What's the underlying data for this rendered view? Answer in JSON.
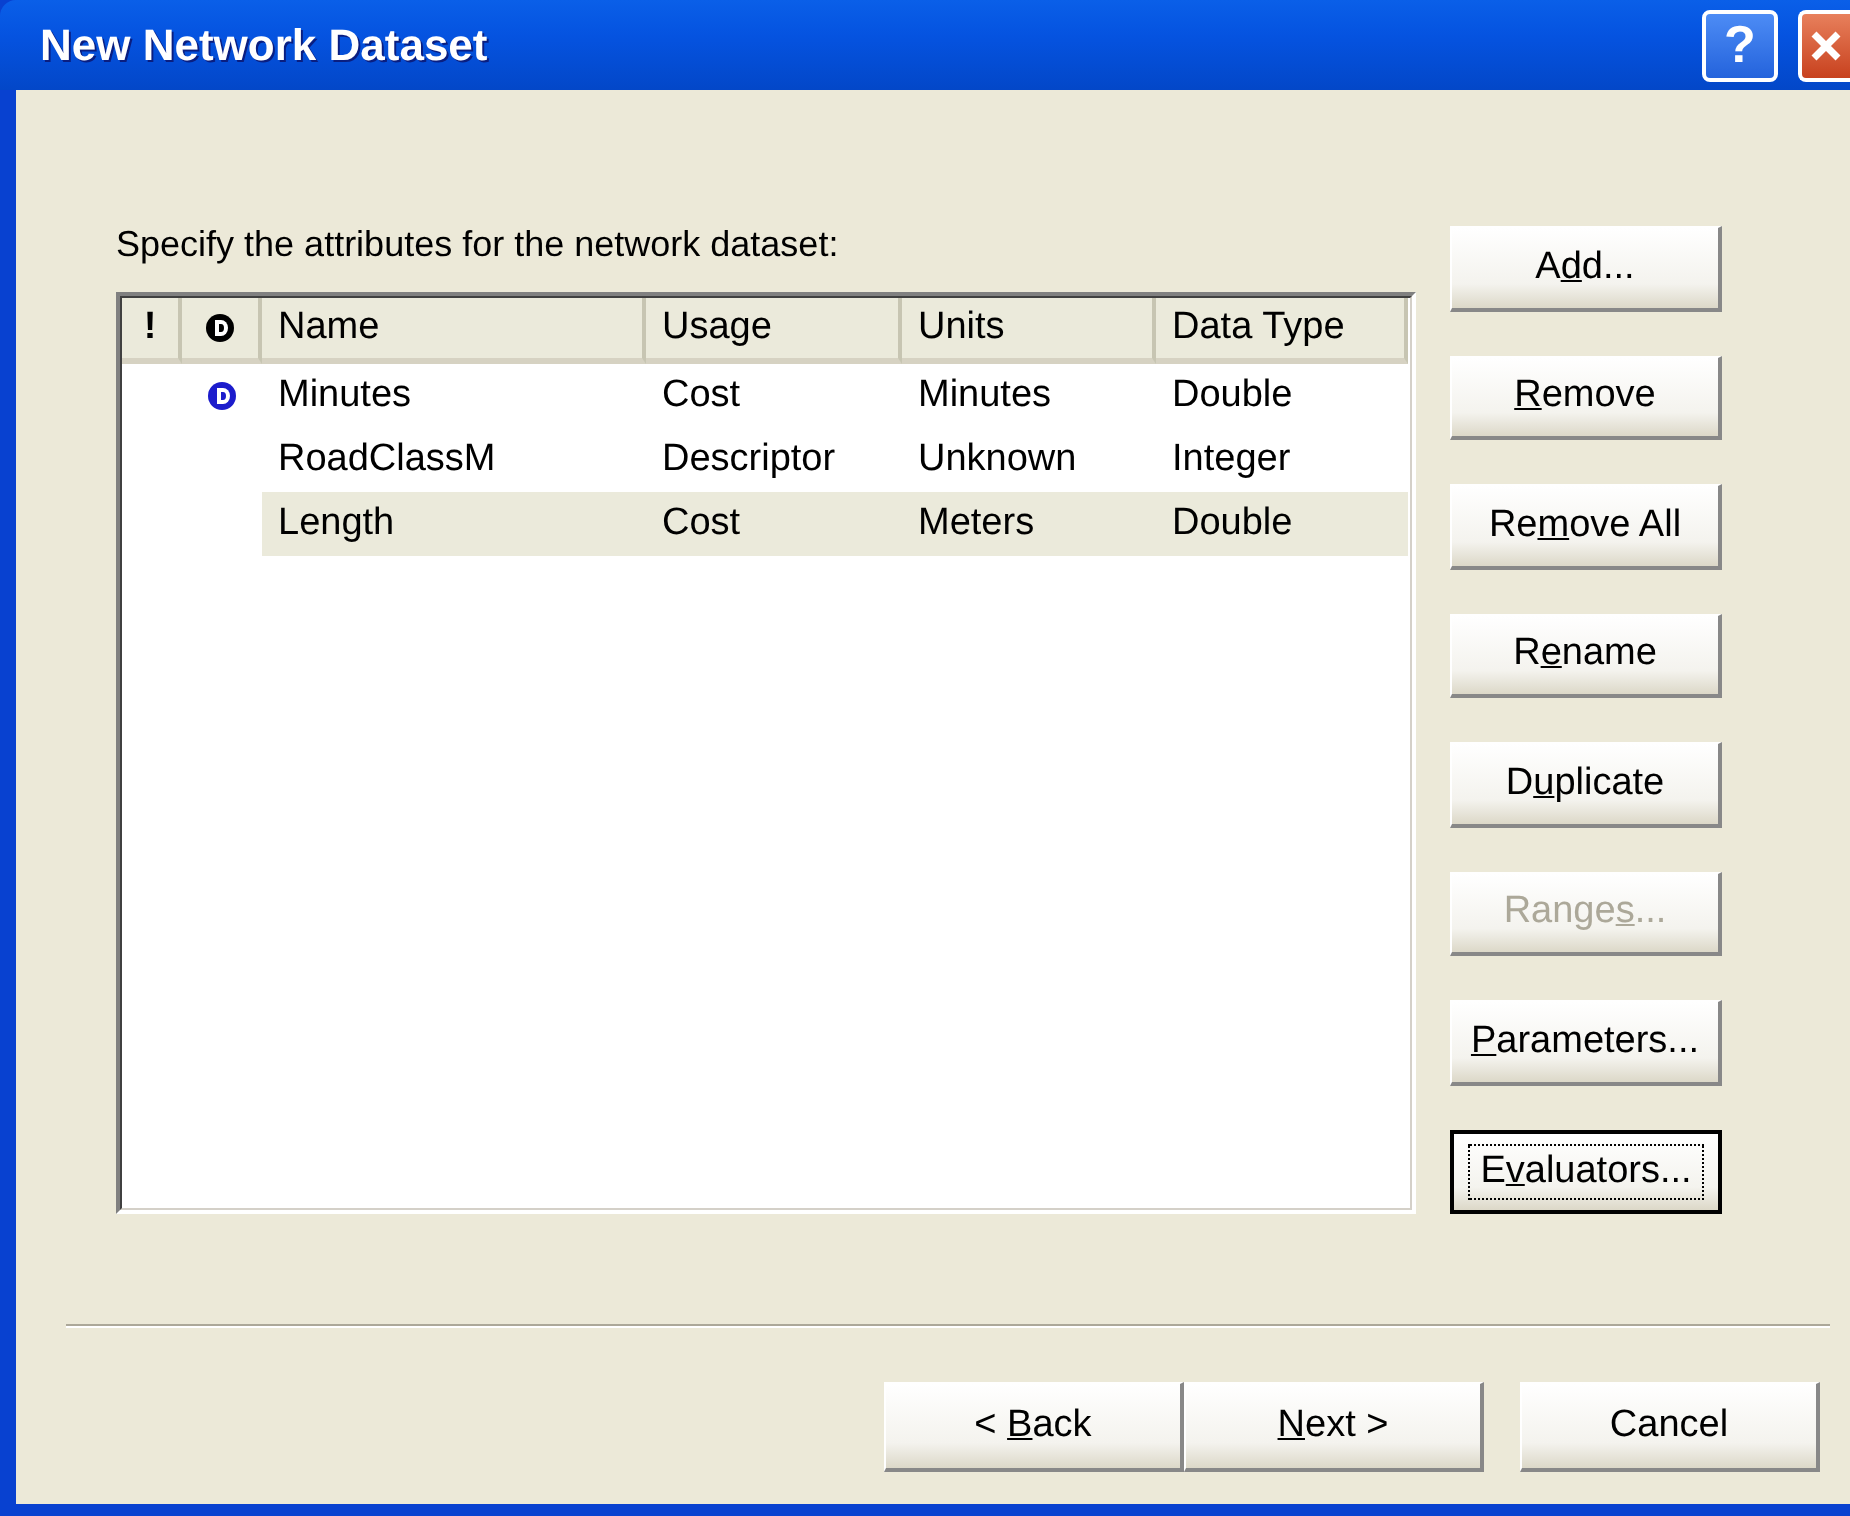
{
  "window": {
    "title": "New Network Dataset",
    "help_button": "?"
  },
  "prompt": "Specify the attributes for the network dataset:",
  "table": {
    "columns": [
      {
        "kind": "text",
        "label": "!"
      },
      {
        "kind": "icon"
      },
      {
        "kind": "text",
        "label": "Name"
      },
      {
        "kind": "text",
        "label": "Usage"
      },
      {
        "kind": "text",
        "label": "Units"
      },
      {
        "kind": "text",
        "label": "Data Type"
      }
    ],
    "rows": [
      {
        "default": true,
        "selected": false,
        "cells": [
          "",
          "",
          "Minutes",
          "Cost",
          "Minutes",
          "Double"
        ]
      },
      {
        "default": false,
        "selected": false,
        "cells": [
          "",
          "",
          "RoadClassM",
          "Descriptor",
          "Unknown",
          "Integer"
        ]
      },
      {
        "default": false,
        "selected": true,
        "cells": [
          "",
          "",
          "Length",
          "Cost",
          "Meters",
          "Double"
        ]
      }
    ]
  },
  "side_buttons": [
    {
      "pre": "A",
      "key": "d",
      "post": "d...",
      "disabled": false,
      "focused": false
    },
    {
      "key": "R",
      "post": "emove",
      "disabled": false,
      "focused": false
    },
    {
      "pre": "Re",
      "key": "m",
      "post": "ove All",
      "disabled": false,
      "focused": false
    },
    {
      "pre": "R",
      "key": "e",
      "post": "name",
      "disabled": false,
      "focused": false
    },
    {
      "pre": "D",
      "key": "u",
      "post": "plicate",
      "disabled": false,
      "focused": false
    },
    {
      "pre": "Range",
      "key": "s",
      "post": "...",
      "disabled": true,
      "focused": false
    },
    {
      "key": "P",
      "post": "arameters...",
      "disabled": false,
      "focused": false
    },
    {
      "pre": "E",
      "key": "v",
      "post": "aluators...",
      "disabled": false,
      "focused": true
    }
  ],
  "footer_buttons": [
    {
      "pre": "< ",
      "key": "B",
      "post": "ack",
      "disabled": false
    },
    {
      "key": "N",
      "post": "ext >",
      "disabled": false
    },
    {
      "post": "Cancel",
      "disabled": false
    }
  ]
}
